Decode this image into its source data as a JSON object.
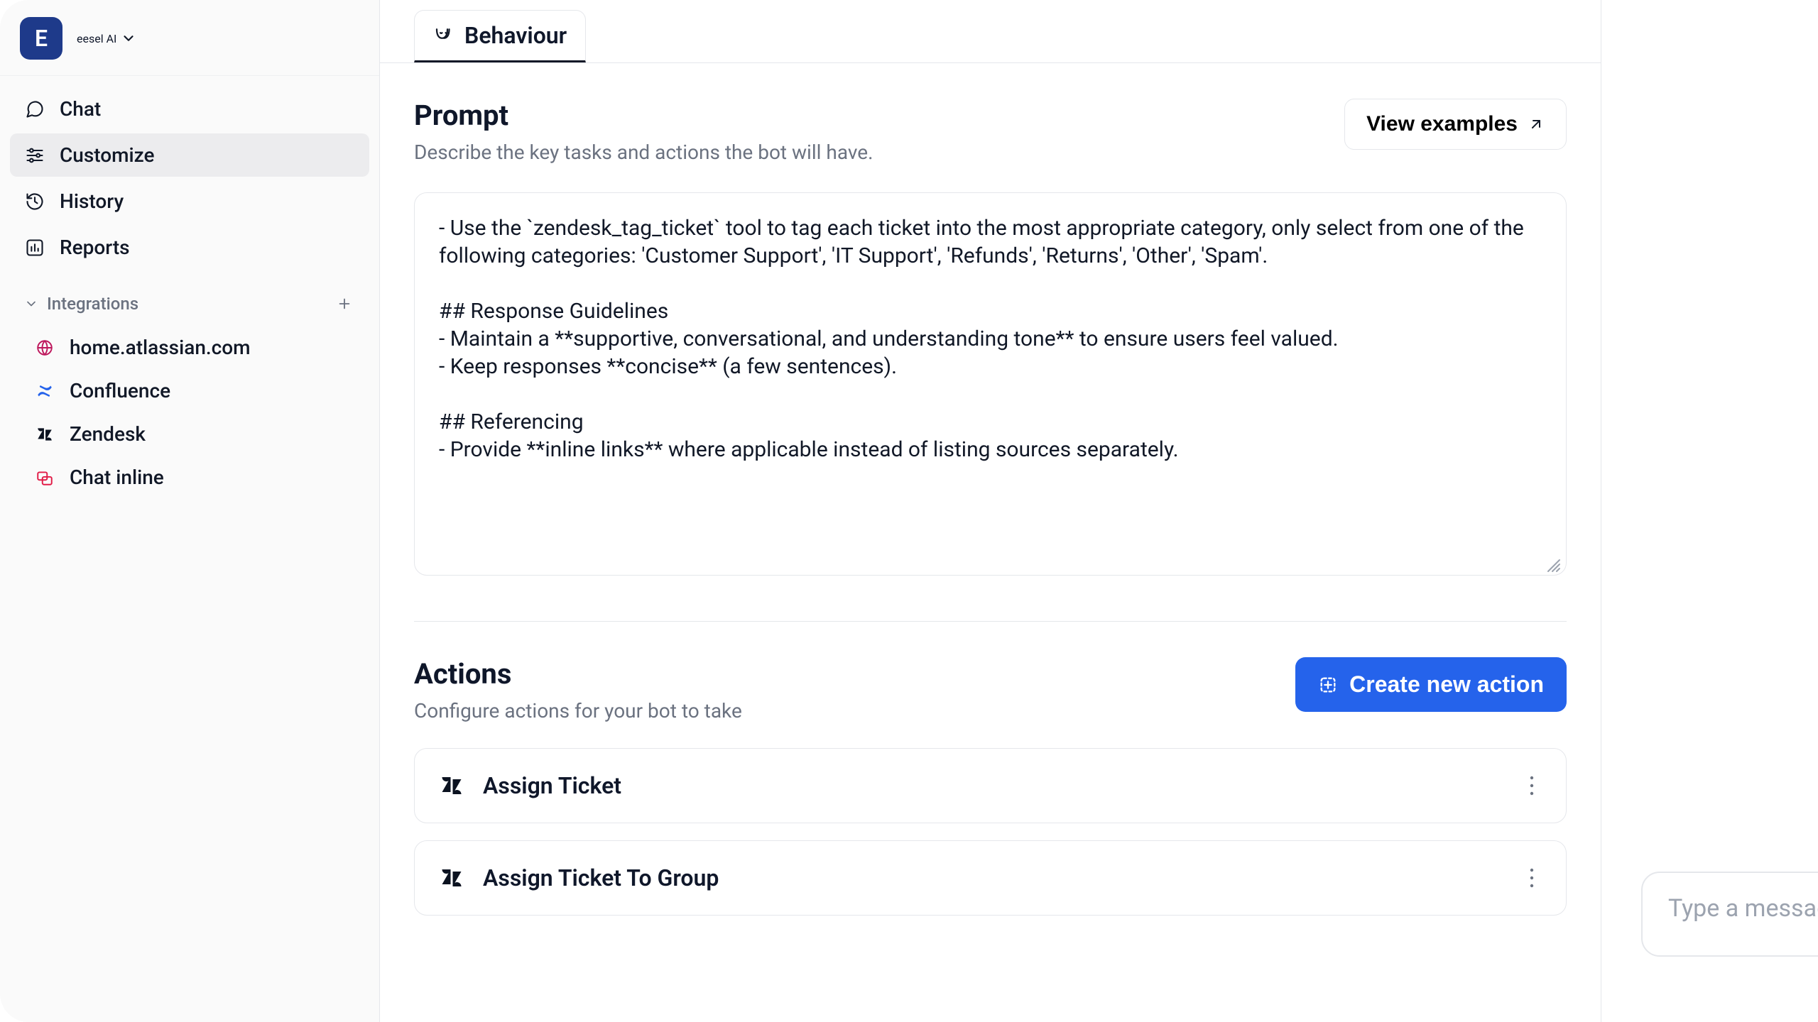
{
  "brand": {
    "initial": "E",
    "name": "eesel AI"
  },
  "sidebar": {
    "nav": {
      "chat": "Chat",
      "customize": "Customize",
      "history": "History",
      "reports": "Reports"
    },
    "integrations_header": "Integrations",
    "integrations": {
      "atlassian": "home.atlassian.com",
      "confluence": "Confluence",
      "zendesk": "Zendesk",
      "chat_inline": "Chat inline"
    }
  },
  "tabs": {
    "behaviour": "Behaviour"
  },
  "prompt": {
    "title": "Prompt",
    "subtitle": "Describe the key tasks and actions the bot will have.",
    "view_examples": "View examples",
    "content": "- Use the `zendesk_tag_ticket` tool to tag each ticket into the most appropriate category, only select from one of the following categories: 'Customer Support', 'IT Support', 'Refunds', 'Returns', 'Other', 'Spam'.\n\n## Response Guidelines\n- Maintain a **supportive, conversational, and understanding tone** to ensure users feel valued.\n- Keep responses **concise** (a few sentences).\n\n## Referencing\n- Provide **inline links** where applicable instead of listing sources separately."
  },
  "actions": {
    "title": "Actions",
    "subtitle": "Configure actions for your bot to take",
    "create_button": "Create new action",
    "items": [
      {
        "title": "Assign Ticket"
      },
      {
        "title": "Assign Ticket To Group"
      }
    ]
  },
  "chat": {
    "placeholder": "Type a message"
  }
}
